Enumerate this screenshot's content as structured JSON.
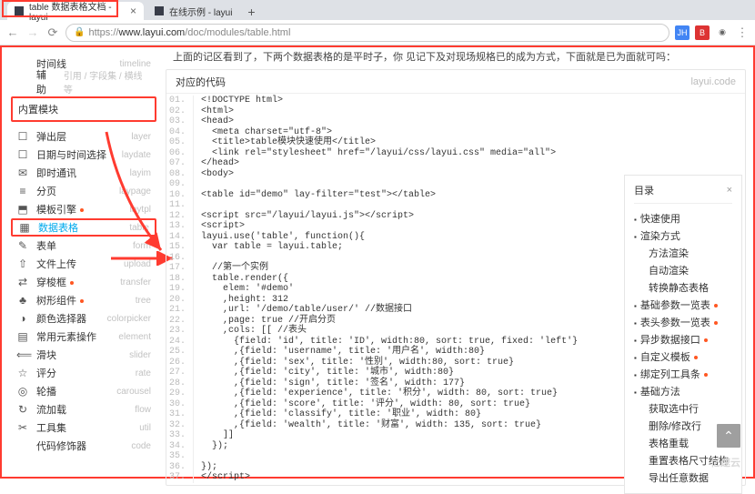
{
  "browser": {
    "tabs": [
      {
        "title": "table 数据表格文档 - layui"
      },
      {
        "title": "在线示例 - layui"
      }
    ],
    "url_prefix": "https://",
    "url_host": "www.layui.com",
    "url_path": "/doc/modules/table.html",
    "ext": {
      "jh": "JH",
      "b": "B"
    }
  },
  "truncated_text": "上面的记区看到了，下两个数据表格的是平时子，你   见记下及对现场规格已的成为方式，下面就是已为面就可吗：",
  "sidebar": {
    "items": [
      {
        "ico": "",
        "label": "时间线",
        "sub": "timeline"
      },
      {
        "ico": "",
        "label": "辅助",
        "sub": "引用 / 字段集 / 横线等"
      }
    ],
    "groupHeader": "内置模块",
    "modules": [
      {
        "ico": "☐",
        "label": "弹出层",
        "sub": "layer"
      },
      {
        "ico": "☐",
        "label": "日期与时间选择",
        "sub": "laydate"
      },
      {
        "ico": "✉",
        "label": "即时通讯",
        "sub": "layim"
      },
      {
        "ico": "≡",
        "label": "分页",
        "sub": "laypage"
      },
      {
        "ico": "⬒",
        "label": "模板引擎",
        "sub": "laytpl",
        "dot": true
      },
      {
        "ico": "▦",
        "label": "数据表格",
        "sub": "table"
      },
      {
        "ico": "✎",
        "label": "表单",
        "sub": "form"
      },
      {
        "ico": "⇧",
        "label": "文件上传",
        "sub": "upload"
      },
      {
        "ico": "⇄",
        "label": "穿梭框",
        "sub": "transfer",
        "dot": true
      },
      {
        "ico": "♣",
        "label": "树形组件",
        "sub": "tree",
        "dot": true
      },
      {
        "ico": "◑",
        "label": "颜色选择器",
        "sub": "colorpicker"
      },
      {
        "ico": "▤",
        "label": "常用元素操作",
        "sub": "element"
      },
      {
        "ico": "⟸",
        "label": "滑块",
        "sub": "slider"
      },
      {
        "ico": "☆",
        "label": "评分",
        "sub": "rate"
      },
      {
        "ico": "◎",
        "label": "轮播",
        "sub": "carousel"
      },
      {
        "ico": "↻",
        "label": "流加载",
        "sub": "flow"
      },
      {
        "ico": "✂",
        "label": "工具集",
        "sub": "util"
      },
      {
        "ico": "</>",
        "label": "代码修饰器",
        "sub": "code"
      }
    ]
  },
  "codePanel": {
    "title": "对应的代码",
    "right": "layui.code",
    "lines": [
      "<!DOCTYPE html>",
      "<html>",
      "<head>",
      "  <meta charset=\"utf-8\">",
      "  <title>table模块快速使用</title>",
      "  <link rel=\"stylesheet\" href=\"/layui/css/layui.css\" media=\"all\">",
      "</head>",
      "<body>",
      " ",
      "<table id=\"demo\" lay-filter=\"test\"></table>",
      " ",
      "<script src=\"/layui/layui.js\"></script>",
      "<script>",
      "layui.use('table', function(){",
      "  var table = layui.table;",
      "  ",
      "  //第一个实例",
      "  table.render({",
      "    elem: '#demo'",
      "    ,height: 312",
      "    ,url: '/demo/table/user/' //数据接口",
      "    ,page: true //开启分页",
      "    ,cols: [[ //表头",
      "      {field: 'id', title: 'ID', width:80, sort: true, fixed: 'left'}",
      "      ,{field: 'username', title: '用户名', width:80}",
      "      ,{field: 'sex', title: '性别', width:80, sort: true}",
      "      ,{field: 'city', title: '城市', width:80}",
      "      ,{field: 'sign', title: '签名', width: 177}",
      "      ,{field: 'experience', title: '积分', width: 80, sort: true}",
      "      ,{field: 'score', title: '评分', width: 80, sort: true}",
      "      ,{field: 'classify', title: '职业', width: 80}",
      "      ,{field: 'wealth', title: '财富', width: 135, sort: true}",
      "    ]]",
      "  });",
      "  ",
      "});",
      "</script>"
    ]
  },
  "toc": {
    "title": "目录",
    "items": [
      {
        "label": "快速使用"
      },
      {
        "label": "渲染方式"
      },
      {
        "label": "方法渲染",
        "sub": true
      },
      {
        "label": "自动渲染",
        "sub": true
      },
      {
        "label": "转换静态表格",
        "sub": true
      },
      {
        "label": "基础参数一览表",
        "dot": true
      },
      {
        "label": "表头参数一览表",
        "dot": true
      },
      {
        "label": "异步数据接口",
        "dot": true
      },
      {
        "label": "自定义模板",
        "dot": true
      },
      {
        "label": "绑定列工具条",
        "dot": true
      },
      {
        "label": "基础方法"
      },
      {
        "label": "获取选中行",
        "sub": true
      },
      {
        "label": "删除/修改行",
        "sub": true
      },
      {
        "label": "表格重载",
        "sub": true
      },
      {
        "label": "重置表格尺寸结构",
        "sub": true
      },
      {
        "label": "导出任意数据",
        "sub": true
      }
    ]
  },
  "watermark": "亿速云"
}
